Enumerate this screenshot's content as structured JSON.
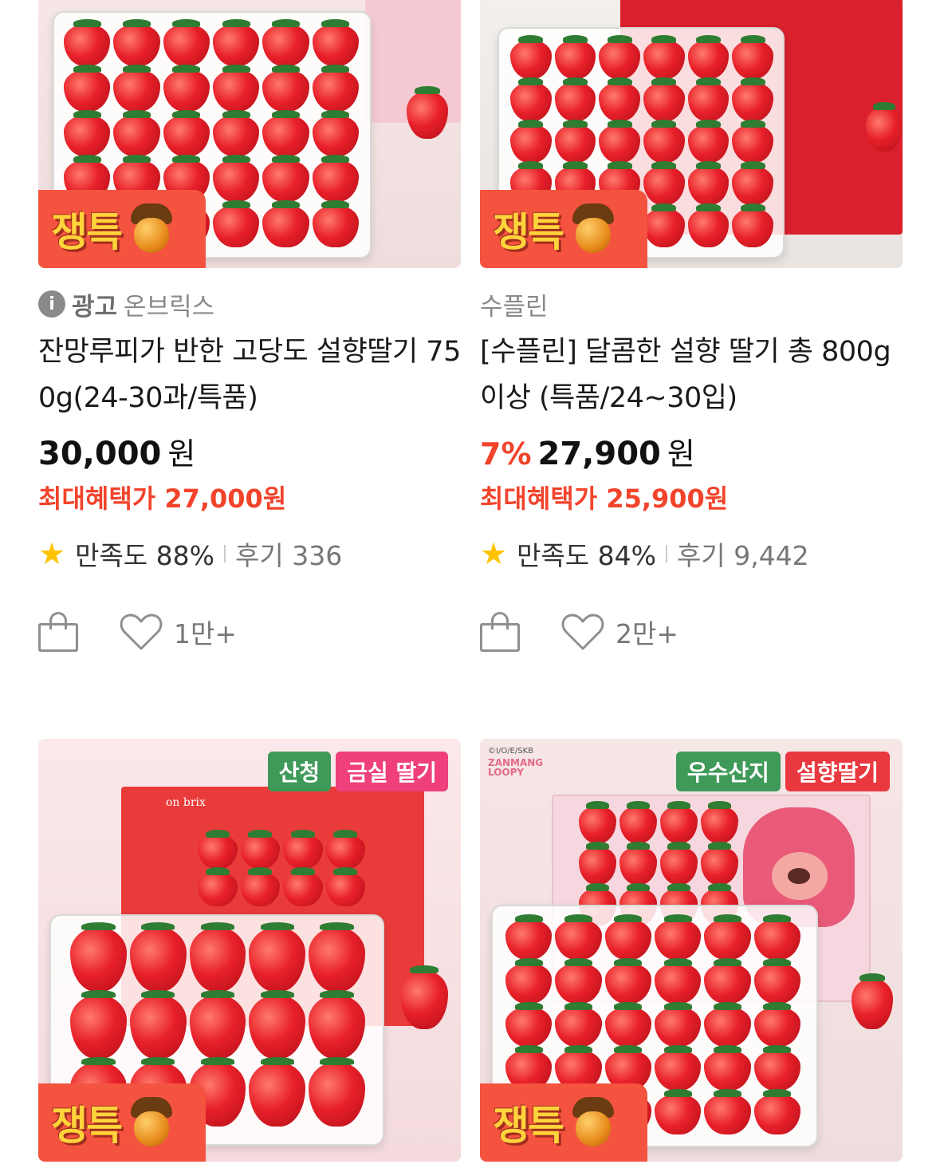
{
  "products": [
    {
      "deal_badge": "쟁특",
      "ad_label": "광고",
      "seller": "온브릭스",
      "title": "잔망루피가 반한 고당도 설향딸기 750g(24-30과/특품)",
      "discount": "",
      "price": "30,000",
      "currency": "원",
      "benefit": "최대혜택가 27,000원",
      "rating_label": "만족도 88%",
      "review_label": "후기 336",
      "wish_count": "1만+"
    },
    {
      "deal_badge": "쟁특",
      "ad_label": "",
      "seller": "수플린",
      "title": "[수플린] 달콤한 설향 딸기 총 800g 이상 (특품/24~30입)",
      "discount": "7%",
      "price": "27,900",
      "currency": "원",
      "benefit": "최대혜택가 25,900원",
      "rating_label": "만족도 84%",
      "review_label": "후기 9,442",
      "wish_count": "2만+"
    },
    {
      "deal_badge": "쟁특",
      "tags": [
        "산청",
        "금실 딸기"
      ],
      "box_brand": "on brix"
    },
    {
      "deal_badge": "쟁특",
      "tags": [
        "우수산지",
        "설향딸기"
      ],
      "copyright": "©I/O/E/SKB",
      "brand_mark": "ZANMANG LOOPY"
    }
  ],
  "colors": {
    "accent_red": "#f2432b",
    "deal_badge_bg": "#f4533f",
    "star": "#ffc400",
    "tag_green": "#3f9a59",
    "tag_pink": "#ef3f7d",
    "tag_red": "#e9383f"
  }
}
